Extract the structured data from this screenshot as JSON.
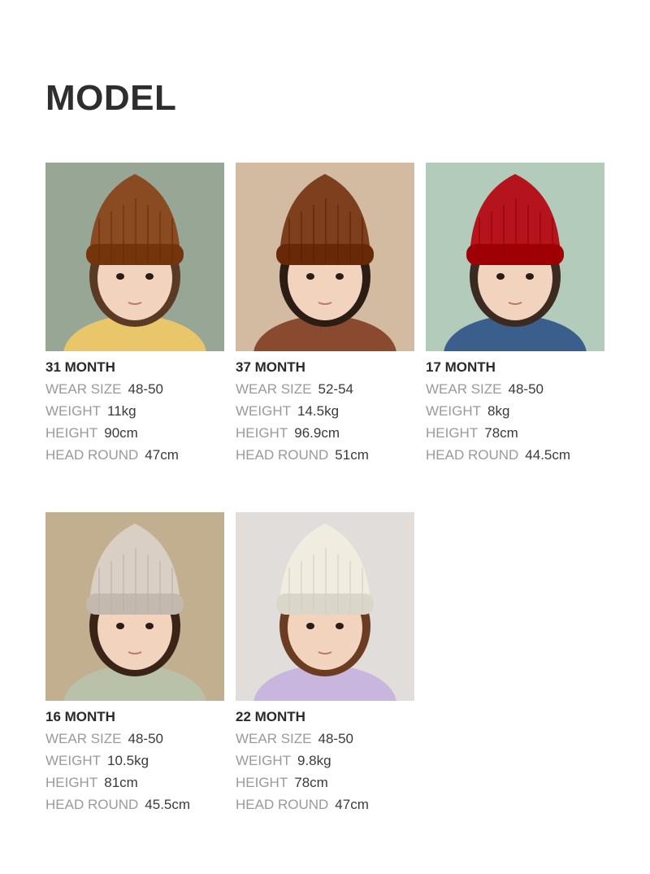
{
  "page_title": "MODEL",
  "models": [
    {
      "age": "31 MONTH",
      "specs": [
        {
          "label": "WEAR SIZE",
          "value": "48-50"
        },
        {
          "label": "WEIGHT",
          "value": "11kg"
        },
        {
          "label": "HEIGHT",
          "value": "90cm"
        },
        {
          "label": "HEAD ROUND",
          "value": "47cm"
        }
      ],
      "photo": {
        "bg": "#9fae9c",
        "hat": "#8a4a22",
        "shirt": "#e9c66a",
        "hair": "#5a3a24"
      }
    },
    {
      "age": "37 MONTH",
      "specs": [
        {
          "label": "WEAR SIZE",
          "value": "52-54"
        },
        {
          "label": "WEIGHT",
          "value": "14.5kg"
        },
        {
          "label": "HEIGHT",
          "value": "96.9cm"
        },
        {
          "label": "HEAD ROUND",
          "value": "51cm"
        }
      ],
      "photo": {
        "bg": "#d9c2a8",
        "hat": "#7e3f1e",
        "shirt": "#8a4a30",
        "hair": "#2b1c14"
      }
    },
    {
      "age": "17 MONTH",
      "specs": [
        {
          "label": "WEAR SIZE",
          "value": "48-50"
        },
        {
          "label": "WEIGHT",
          "value": "8kg"
        },
        {
          "label": "HEIGHT",
          "value": "78cm"
        },
        {
          "label": "HEAD ROUND",
          "value": "44.5cm"
        }
      ],
      "photo": {
        "bg": "#b9d1c0",
        "hat": "#b5141c",
        "shirt": "#3b5f8c",
        "hair": "#3a2a20"
      }
    },
    {
      "age": "16 MONTH",
      "specs": [
        {
          "label": "WEAR SIZE",
          "value": "48-50"
        },
        {
          "label": "WEIGHT",
          "value": "10.5kg"
        },
        {
          "label": "HEIGHT",
          "value": "81cm"
        },
        {
          "label": "HEAD ROUND",
          "value": "45.5cm"
        }
      ],
      "photo": {
        "bg": "#c8b696",
        "hat": "#d9cfc4",
        "shirt": "#b9c2a8",
        "hair": "#3a2418"
      }
    },
    {
      "age": "22 MONTH",
      "specs": [
        {
          "label": "WEAR SIZE",
          "value": "48-50"
        },
        {
          "label": "WEIGHT",
          "value": "9.8kg"
        },
        {
          "label": "HEIGHT",
          "value": "78cm"
        },
        {
          "label": "HEAD ROUND",
          "value": "47cm"
        }
      ],
      "photo": {
        "bg": "#e6e3e0",
        "hat": "#f1ece0",
        "shirt": "#c8b6de",
        "hair": "#6a3c22"
      }
    }
  ]
}
